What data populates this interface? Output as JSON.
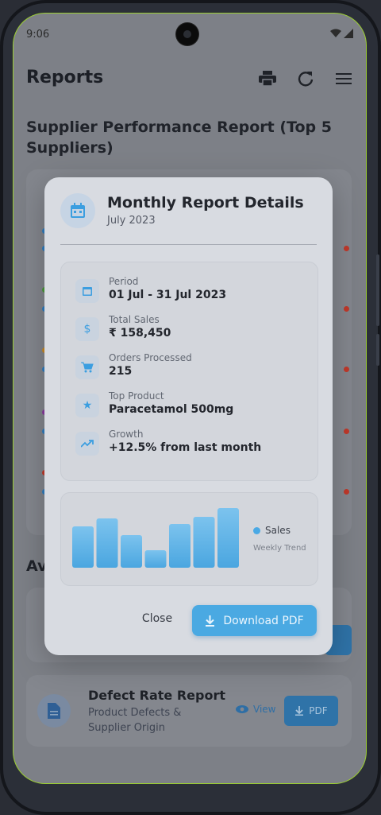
{
  "status_bar": {
    "time": "9:06"
  },
  "appbar": {
    "title": "Reports",
    "icons": [
      "print-icon",
      "refresh-icon",
      "menu-icon"
    ]
  },
  "background": {
    "section_title": "Supplier Performance Report (Top 5 Suppliers)",
    "available_title_partial": "Av",
    "defect_card": {
      "title": "Defect Rate Report",
      "subtitle": "Product Defects & Supplier Origin",
      "view_label": "View",
      "pdf_label": "PDF"
    }
  },
  "dialog": {
    "title": "Monthly Report Details",
    "subtitle": "July 2023",
    "details": [
      {
        "icon": "calendar-icon",
        "label": "Period",
        "value": "01 Jul - 31 Jul 2023"
      },
      {
        "icon": "dollar-icon",
        "label": "Total Sales",
        "value": "₹ 158,450"
      },
      {
        "icon": "cart-icon",
        "label": "Orders Processed",
        "value": "215"
      },
      {
        "icon": "star-icon",
        "label": "Top Product",
        "value": "Paracetamol 500mg"
      },
      {
        "icon": "trending-up-icon",
        "label": "Growth",
        "value": "+12.5% from last month"
      }
    ],
    "chart_legend": "Sales",
    "chart_caption": "Weekly Trend",
    "close_label": "Close",
    "download_label": "Download PDF"
  },
  "chart_data": {
    "type": "bar",
    "series": [
      {
        "name": "Sales",
        "values": [
          52,
          62,
          41,
          22,
          55,
          64,
          75
        ]
      }
    ],
    "ylim": [
      0,
      80
    ],
    "legend": "right",
    "grid": false
  },
  "colors": {
    "accent": "#4aa9e2",
    "dialog_bg": "#d8dbe1"
  }
}
